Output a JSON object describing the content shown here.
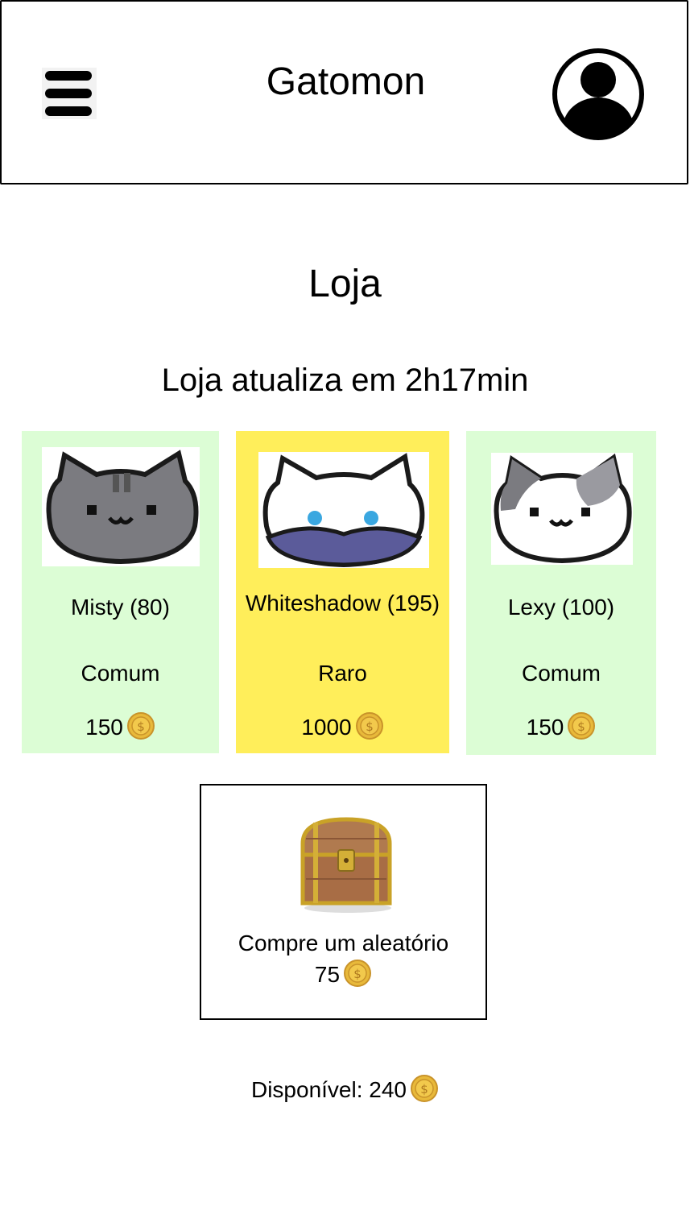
{
  "header": {
    "title": "Gatomon",
    "menu_icon": "hamburger-menu-icon",
    "profile_icon": "user-avatar-icon"
  },
  "shop": {
    "title": "Loja",
    "refresh_text": "Loja atualiza em 2h17min"
  },
  "cards": [
    {
      "name": "Misty (80)",
      "rarity": "Comum",
      "price": "150",
      "color": "#dcfdd5",
      "icon": "gray-tabby-cat-icon"
    },
    {
      "name": "Whiteshadow (195)",
      "rarity": "Raro",
      "price": "1000",
      "color": "#ffee5a",
      "icon": "white-masked-cat-icon"
    },
    {
      "name": "Lexy (100)",
      "rarity": "Comum",
      "price": "150",
      "color": "#dcfdd5",
      "icon": "white-gray-cat-icon"
    }
  ],
  "random": {
    "label": "Compre um aleatório",
    "price": "75",
    "icon": "treasure-chest-icon"
  },
  "available": {
    "text": "Disponível: 240",
    "icon": "coin-icon"
  }
}
